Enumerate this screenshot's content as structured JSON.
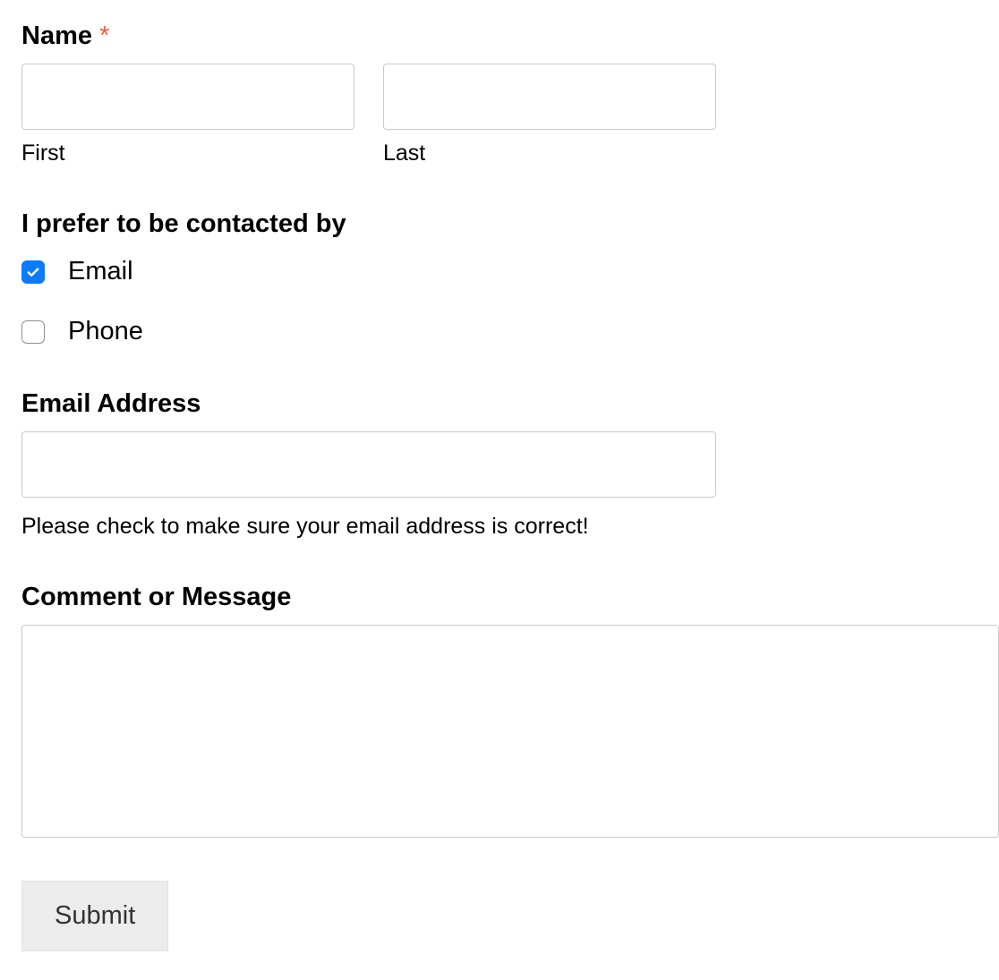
{
  "name": {
    "label": "Name",
    "required_marker": "*",
    "first_sublabel": "First",
    "last_sublabel": "Last",
    "first_value": "",
    "last_value": ""
  },
  "contact_pref": {
    "label": "I prefer to be contacted by",
    "options": [
      {
        "label": "Email",
        "checked": true
      },
      {
        "label": "Phone",
        "checked": false
      }
    ]
  },
  "email": {
    "label": "Email Address",
    "value": "",
    "helper": "Please check to make sure your email address is correct!"
  },
  "comment": {
    "label": "Comment or Message",
    "value": ""
  },
  "submit": {
    "label": "Submit"
  }
}
